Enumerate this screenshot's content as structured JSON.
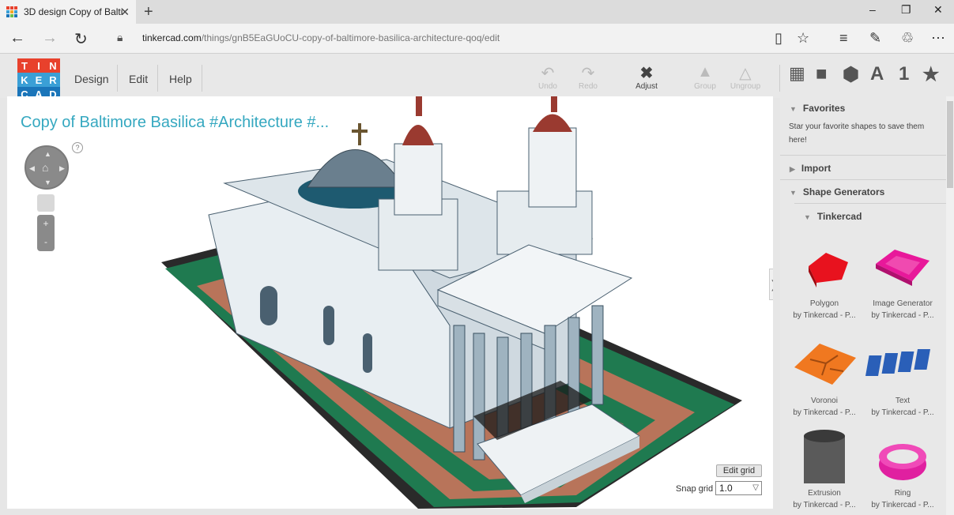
{
  "browser": {
    "tab_title": "3D design Copy of Balti",
    "tab_close": "✕",
    "new_tab": "+",
    "url_host": "tinkercad.com",
    "url_path": "/things/gnB5EaGUoCU-copy-of-baltimore-basilica-architecture-qoq/edit",
    "icons": [
      "back-icon",
      "forward-icon",
      "refresh-icon",
      "lock-icon",
      "reading-view-icon",
      "favorite-star-icon",
      "hub-icon",
      "web-note-icon",
      "share-icon",
      "more-icon"
    ]
  },
  "header": {
    "logo_letters": [
      "T",
      "I",
      "N",
      "K",
      "E",
      "R",
      "C",
      "A",
      "D"
    ],
    "logo_colors": [
      "#e8412c",
      "#e8412c",
      "#e8412c",
      "#3a9fd6",
      "#3a9fd6",
      "#3a9fd6",
      "#1a75b9",
      "#1a75b9",
      "#1a75b9"
    ],
    "menu": [
      "Design",
      "Edit",
      "Help"
    ],
    "tools": [
      {
        "label": "Undo",
        "icon": "undo-icon"
      },
      {
        "label": "Redo",
        "icon": "redo-icon"
      },
      {
        "label": "Adjust",
        "icon": "adjust-icon"
      },
      {
        "label": "Group",
        "icon": "group-icon"
      },
      {
        "label": "Ungroup",
        "icon": "ungroup-icon"
      }
    ],
    "panel_tabs": [
      "grid-icon",
      "box-icon",
      "shapes-icon",
      "A",
      "1",
      "★"
    ]
  },
  "viewport": {
    "title": "Copy of Baltimore Basilica #Architecture #...",
    "help": "?",
    "zoom_in": "+",
    "zoom_out": "-",
    "expander": "❯",
    "edit_grid": "Edit grid",
    "snap_label": "Snap grid",
    "snap_value": "1.0"
  },
  "panel": {
    "favorites": "Favorites",
    "favorites_desc": "Star your favorite shapes to save them here!",
    "import": "Import",
    "generators": "Shape Generators",
    "tinkercad": "Tinkercad",
    "shapes": [
      {
        "name": "Polygon",
        "by": "by Tinkercad - P...",
        "color": "#e8121e"
      },
      {
        "name": "Image Generator",
        "by": "by Tinkercad - P...",
        "color": "#e8189a"
      },
      {
        "name": "Voronoi",
        "by": "by Tinkercad - P...",
        "color": "#f07820"
      },
      {
        "name": "Text",
        "by": "by Tinkercad - P...",
        "color": "#2a5fb8"
      },
      {
        "name": "Extrusion",
        "by": "by Tinkercad - P...",
        "color": "#5a5a5a"
      },
      {
        "name": "Ring",
        "by": "by Tinkercad - P...",
        "color": "#e020a0"
      }
    ]
  }
}
